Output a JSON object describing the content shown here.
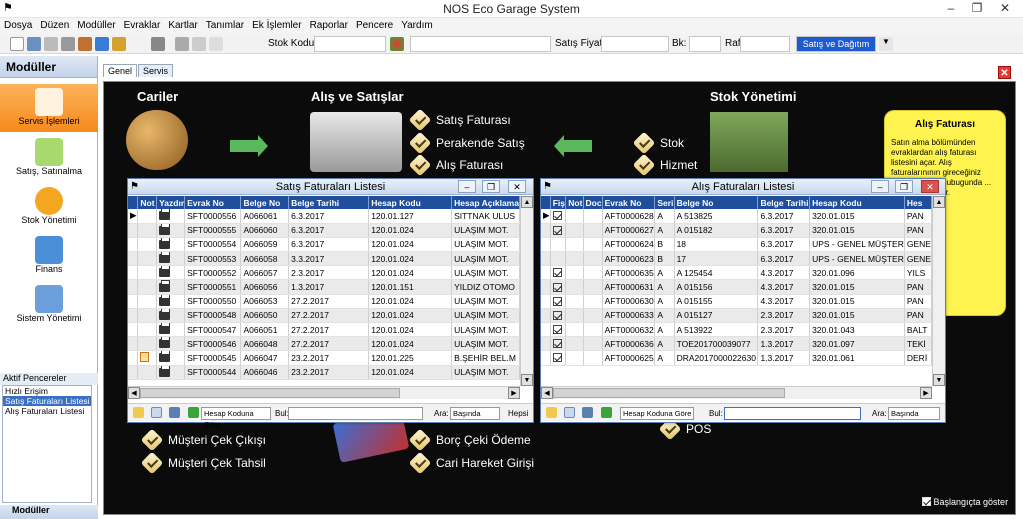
{
  "app": {
    "title": "NOS Eco Garage System"
  },
  "menu": [
    "Dosya",
    "Düzen",
    "Modüller",
    "Evraklar",
    "Kartlar",
    "Tanımlar",
    "Ek İşlemler",
    "Raporlar",
    "Pencere",
    "Yardım"
  ],
  "toolbar": {
    "stok_kodu_label": "Stok Kodu",
    "satis_fiyati_label": "Satış Fiyatı",
    "bk_label": "Bk:",
    "raf_label": "Raf",
    "satis_dagitim_label": "Satış ve Dağıtım"
  },
  "sidebar": {
    "header": "Modüller",
    "items": [
      {
        "label": "Servis İşlemleri",
        "icon": "tools-icon"
      },
      {
        "label": "Satış, Satınalma",
        "icon": "pencil-check-icon"
      },
      {
        "label": "Stok Yönetimi",
        "icon": "gear-icon"
      },
      {
        "label": "Finans",
        "icon": "folder-icon"
      },
      {
        "label": "Sistem Yönetimi",
        "icon": "computer-icon"
      }
    ],
    "aktif_header": "Aktif Pencereler",
    "aktif_items": [
      "Hızlı Erişim",
      "Satış Faturaları Listesi",
      "Alış Faturaları Listesi"
    ],
    "moduller_button": "Modüller"
  },
  "tabs": [
    "Genel",
    "Servis"
  ],
  "dashboard": {
    "cariler": "Cariler",
    "alis_satis": "Alış ve Satışlar",
    "stok_yonetimi": "Stok Yönetimi",
    "links_sales": [
      "Satış Faturası",
      "Perakende Satış",
      "Alış Faturası"
    ],
    "links_stock": [
      "Stok",
      "Hizmet"
    ],
    "links_bottom_left": [
      "Müşteri Çek Çıkışı",
      "Müşteri Çek Tahsil"
    ],
    "links_bottom_mid": [
      "Borç Çeki Ödeme",
      "Cari Hareket Girişi"
    ],
    "link_pos": "POS",
    "note_title": "Alış Faturası",
    "note_body": "Satın alma bölümünden evraklardan alış faturası listesini açar. Alış faturalarınının gireceğiniz ekrandır. Aras cubugunda ... astığınızda ... ur.",
    "startup_label": "Başlangıçta göster"
  },
  "satis_window": {
    "title": "Satış Faturaları Listesi",
    "columns": [
      "Not",
      "Yazdır",
      "Evrak No",
      "Belge No",
      "Belge Tarihi",
      "Hesap Kodu",
      "Hesap Açıklama"
    ],
    "rows": [
      [
        "",
        "",
        "SFT0000556",
        "A066061",
        "6.3.2017",
        "120.01.127",
        "SITTNAK ULUS"
      ],
      [
        "",
        "",
        "SFT0000555",
        "A066060",
        "6.3.2017",
        "120.01.024",
        "ULAŞIM MOT."
      ],
      [
        "",
        "",
        "SFT0000554",
        "A066059",
        "6.3.2017",
        "120.01.024",
        "ULAŞIM MOT."
      ],
      [
        "",
        "",
        "SFT0000553",
        "A066058",
        "3.3.2017",
        "120.01.024",
        "ULAŞIM MOT."
      ],
      [
        "",
        "",
        "SFT0000552",
        "A066057",
        "2.3.2017",
        "120.01.024",
        "ULAŞIM MOT."
      ],
      [
        "",
        "",
        "SFT0000551",
        "A066056",
        "1.3.2017",
        "120.01.151",
        "YILDIZ OTOMO"
      ],
      [
        "",
        "",
        "SFT0000550",
        "A066053",
        "27.2.2017",
        "120.01.024",
        "ULAŞIM MOT."
      ],
      [
        "",
        "",
        "SFT0000548",
        "A066050",
        "27.2.2017",
        "120.01.024",
        "ULAŞIM MOT."
      ],
      [
        "",
        "",
        "SFT0000547",
        "A066051",
        "27.2.2017",
        "120.01.024",
        "ULAŞIM MOT."
      ],
      [
        "",
        "",
        "SFT0000546",
        "A066048",
        "27.2.2017",
        "120.01.024",
        "ULAŞIM MOT."
      ],
      [
        "note",
        "",
        "SFT0000545",
        "A066047",
        "23.2.2017",
        "120.01.225",
        "B.ŞEHİR BEL.M"
      ],
      [
        "",
        "",
        "SFT0000544",
        "A066046",
        "23.2.2017",
        "120.01.024",
        "ULAŞIM MOT."
      ]
    ],
    "filter_select": "Hesap Koduna Göre",
    "bul_label": "Bul:",
    "ara_label": "Ara:",
    "ara_select": "Başında",
    "hepsi": "Hepsi"
  },
  "alis_window": {
    "title": "Alış Faturaları Listesi",
    "columns": [
      "Fiş",
      "Not",
      "Doc",
      "Evrak No",
      "Seri",
      "Belge No",
      "Belge Tarihi",
      "Hesap Kodu",
      "Hes"
    ],
    "rows": [
      [
        true,
        "",
        "",
        "AFT0000628",
        "A",
        "A 513825",
        "6.3.2017",
        "320.01.015",
        "PAN"
      ],
      [
        true,
        "",
        "",
        "AFT0000627",
        "A",
        "A 015182",
        "6.3.2017",
        "320.01.015",
        "PAN"
      ],
      [
        false,
        "",
        "",
        "AFT0000624",
        "B",
        "18",
        "6.3.2017",
        "UPS - GENEL MÜŞTER",
        "GENE"
      ],
      [
        false,
        "",
        "",
        "AFT0000623",
        "B",
        "17",
        "6.3.2017",
        "UPS - GENEL MÜŞTER",
        "GENE"
      ],
      [
        true,
        "",
        "",
        "AFT0000635",
        "A",
        "A 125454",
        "4.3.2017",
        "320.01.096",
        "YILS"
      ],
      [
        true,
        "",
        "",
        "AFT0000631",
        "A",
        "A 015156",
        "4.3.2017",
        "320.01.015",
        "PAN"
      ],
      [
        true,
        "",
        "",
        "AFT0000630",
        "A",
        "A 015155",
        "4.3.2017",
        "320.01.015",
        "PAN"
      ],
      [
        true,
        "",
        "",
        "AFT0000633",
        "A",
        "A 015127",
        "2.3.2017",
        "320.01.015",
        "PAN"
      ],
      [
        true,
        "",
        "",
        "AFT0000632",
        "A",
        "A 513922",
        "2.3.2017",
        "320.01.043",
        "BALT"
      ],
      [
        true,
        "",
        "",
        "AFT0000636",
        "A",
        "TOE201700039077",
        "1.3.2017",
        "320.01.097",
        "TEKİ"
      ],
      [
        true,
        "",
        "",
        "AFT0000625",
        "A",
        "DRA2017000022630",
        "1.3.2017",
        "320.01.061",
        "DERİ"
      ]
    ],
    "filter_select": "Hesap Koduna Göre",
    "bul_label": "Bul:",
    "ara_label": "Ara:",
    "ara_select": "Başında"
  }
}
